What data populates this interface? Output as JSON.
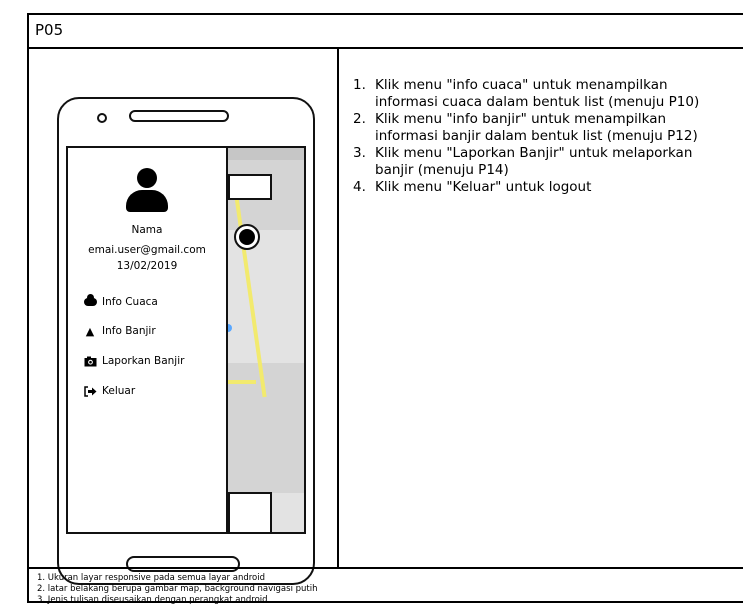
{
  "header": {
    "title": "P05"
  },
  "drawer": {
    "profile": {
      "name": "Nama",
      "email": "emai.user@gmail.com",
      "date": "13/02/2019"
    },
    "menu": [
      {
        "label": "Info Cuaca",
        "icon": "cloud-icon"
      },
      {
        "label": "Info Banjir",
        "icon": "warning-icon"
      },
      {
        "label": "Laporkan Banjir",
        "icon": "camera-icon"
      },
      {
        "label": "Keluar",
        "icon": "logout-icon"
      }
    ]
  },
  "instructions": [
    {
      "num": "1.",
      "text": "Klik menu \"info cuaca\" untuk menampilkan informasi cuaca dalam bentuk list (menuju P10)"
    },
    {
      "num": "2.",
      "text": "Klik menu \"info banjir\" untuk menampilkan informasi banjir dalam bentuk list (menuju P12)"
    },
    {
      "num": "3.",
      "text": "Klik menu \"Laporkan Banjir\" untuk melaporkan banjir (menuju P14)"
    },
    {
      "num": "4.",
      "text": "Klik menu \"Keluar\" untuk logout"
    }
  ],
  "notes": [
    "1. Ukuran layar responsive pada semua layar android",
    "2. latar belakang berupa gambar map, background navigasi putih",
    "3. Jenis tulisan diseusaikan dengan perangkat android"
  ],
  "colors": {
    "map_road": "#f2ea6e",
    "map_marker": "#59a7ff",
    "map_bg": "#e3e3e3"
  }
}
